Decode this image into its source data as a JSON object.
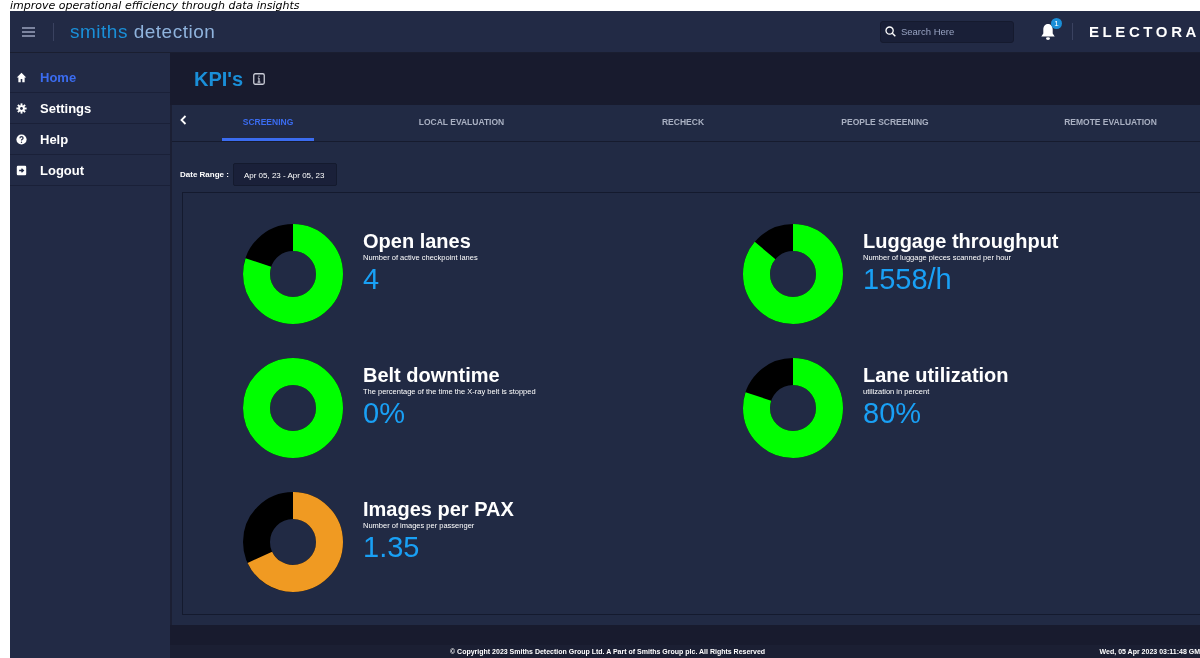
{
  "caption": "improve operational efficiency through data insights",
  "topbar": {
    "logo_part_1": "smiths",
    "logo_part_2": "detection",
    "search": {
      "placeholder": "Search Here"
    },
    "notification_count": "1",
    "product": "ELECTORA"
  },
  "sidebar": {
    "items": [
      {
        "label": "Home",
        "selected": true
      },
      {
        "label": "Settings",
        "selected": false
      },
      {
        "label": "Help",
        "selected": false
      },
      {
        "label": "Logout",
        "selected": false
      }
    ]
  },
  "page_title": "KPI's",
  "tabs": [
    {
      "label": "SCREENING",
      "selected": true
    },
    {
      "label": "LOCAL EVALUATION",
      "selected": false
    },
    {
      "label": "RECHECK",
      "selected": false
    },
    {
      "label": "PEOPLE SCREENING",
      "selected": false
    },
    {
      "label": "REMOTE EVALUATION",
      "selected": false
    }
  ],
  "date_range": {
    "label": "Date Range :",
    "value": "Apr 05, 23 - Apr 05, 23"
  },
  "kpis": [
    {
      "title": "Open lanes",
      "description": "Number of active checkpoint lanes",
      "value": "4"
    },
    {
      "title": "Luggage throughput",
      "description": "Number of luggage pieces scanned per hour",
      "value": "1558/h"
    },
    {
      "title": "Belt downtime",
      "description": "The percentage of the time the X-ray belt is stopped",
      "value": "0%"
    },
    {
      "title": "Lane utilization",
      "description": "utilization in percent",
      "value": "80%"
    },
    {
      "title": "Images per PAX",
      "description": "Number of images per passenger",
      "value": "1.35"
    }
  ],
  "footer": {
    "copyright": "© Copyright 2023 Smiths Detection Group Ltd. A Part of Smiths Group plc. All Rights Reserved",
    "datetime": "Wed, 05 Apr 2023 03:11:48 GM"
  }
}
